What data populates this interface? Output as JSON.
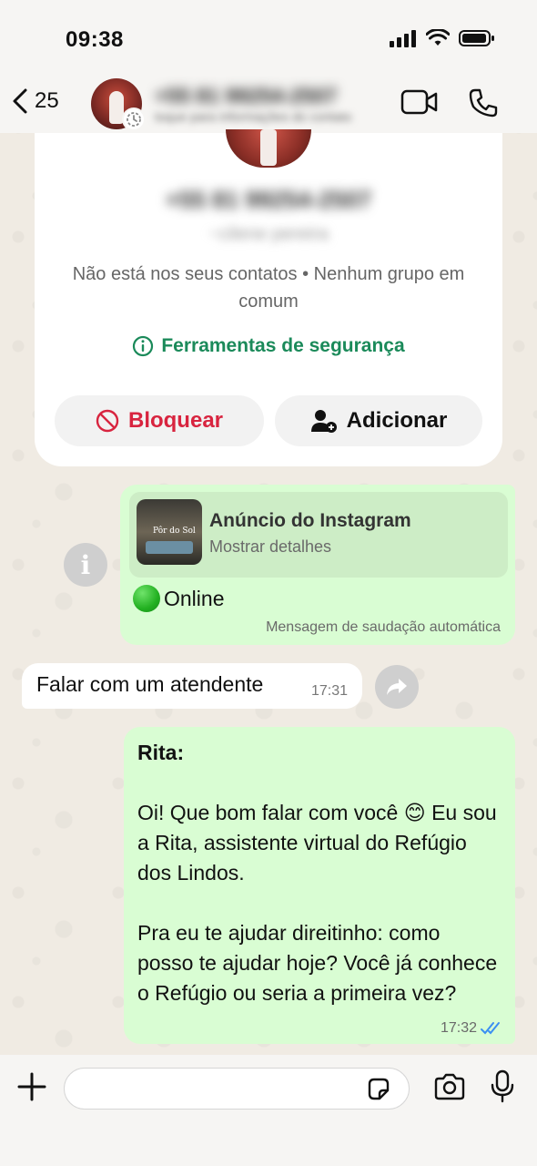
{
  "status_bar": {
    "time": "09:38"
  },
  "header": {
    "back_count": "25",
    "contact_name": "+55 81 99254-2507",
    "contact_subtitle": "toque para informações do contato"
  },
  "info_card": {
    "number": "+55 81 99254-2507",
    "name": "~cilene pereira",
    "description": "Não está nos seus contatos • Nenhum grupo em comum",
    "safety_tools": "Ferramentas de segurança",
    "block_label": "Bloquear",
    "add_label": "Adicionar"
  },
  "messages": {
    "ad": {
      "thumb_text": "Pôr do Sol",
      "title": "Anúncio do Instagram",
      "subtitle": "Mostrar detalhes",
      "text": "Online",
      "footer": "Mensagem de saudação automática"
    },
    "incoming": {
      "text": "Falar com um atendente",
      "time": "17:31"
    },
    "rita": {
      "heading": "Rita:",
      "paragraph1": "Oi! Que bom falar com você 😊 Eu sou a Rita, assistente virtual do Refúgio dos Lindos.",
      "paragraph2": "Pra eu te ajudar direitinho: como posso te ajudar hoje? Você já conhece o Refúgio ou seria a primeira vez?",
      "time": "17:32"
    }
  },
  "composer": {
    "value": ""
  },
  "colors": {
    "outgoing_bubble": "#d9fdd3",
    "safety_green": "#1b8a5a",
    "block_red": "#d8243f",
    "read_ticks": "#3b8ff2"
  }
}
